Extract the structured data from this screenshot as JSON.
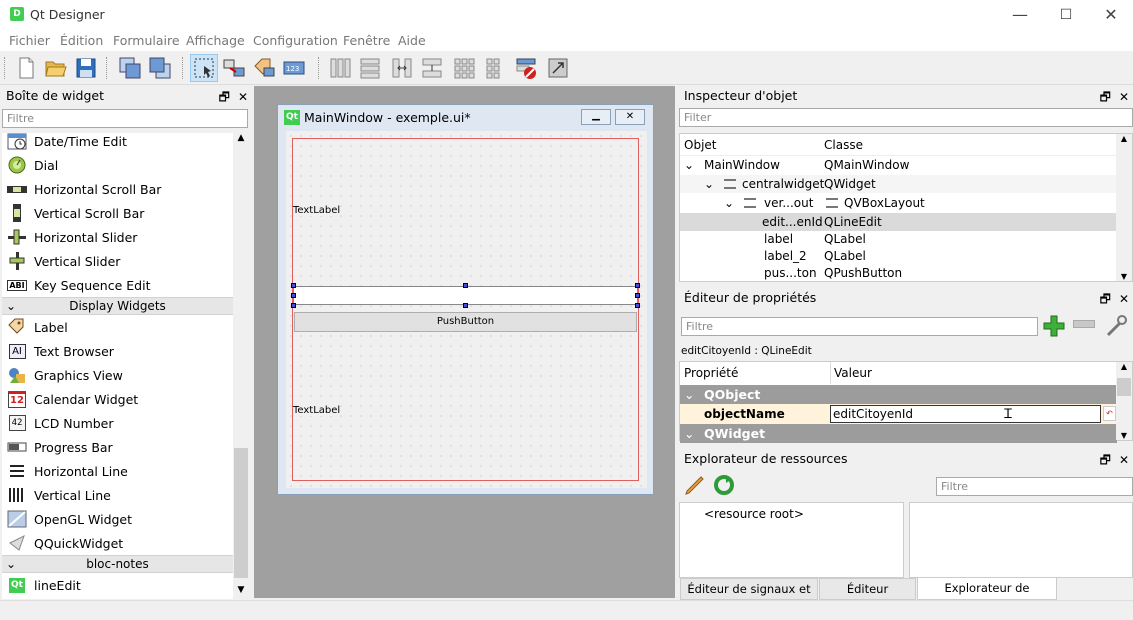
{
  "window": {
    "title": "Qt Designer",
    "icon_letter": "D",
    "minimize": "—",
    "maximize": "☐",
    "close": "✕"
  },
  "menu": [
    "Fichier",
    "Édition",
    "Formulaire",
    "Affichage",
    "Configuration",
    "Fenêtre",
    "Aide"
  ],
  "widget_box": {
    "title": "Boîte de widget",
    "filter_placeholder": "Filtre",
    "items": [
      {
        "label": "Date/Time Edit",
        "icon": "datetime-edit-icon"
      },
      {
        "label": "Dial",
        "icon": "dial-icon"
      },
      {
        "label": "Horizontal Scroll Bar",
        "icon": "hscrollbar-icon"
      },
      {
        "label": "Vertical Scroll Bar",
        "icon": "vscrollbar-icon"
      },
      {
        "label": "Horizontal Slider",
        "icon": "hslider-icon"
      },
      {
        "label": "Vertical Slider",
        "icon": "vslider-icon"
      },
      {
        "label": "Key Sequence Edit",
        "icon": "key-sequence-icon"
      }
    ],
    "category_display": "Display Widgets",
    "display_items": [
      {
        "label": "Label",
        "icon": "label-icon"
      },
      {
        "label": "Text Browser",
        "icon": "text-browser-icon"
      },
      {
        "label": "Graphics View",
        "icon": "graphics-view-icon"
      },
      {
        "label": "Calendar Widget",
        "icon": "calendar-icon"
      },
      {
        "label": "LCD Number",
        "icon": "lcd-number-icon"
      },
      {
        "label": "Progress Bar",
        "icon": "progress-bar-icon"
      },
      {
        "label": "Horizontal Line",
        "icon": "hline-icon"
      },
      {
        "label": "Vertical Line",
        "icon": "vline-icon"
      },
      {
        "label": "OpenGL Widget",
        "icon": "opengl-icon"
      },
      {
        "label": "QQuickWidget",
        "icon": "qquick-icon"
      }
    ],
    "category_notes": "bloc-notes",
    "notes_items": [
      {
        "label": "lineEdit",
        "icon": "qt-icon"
      }
    ],
    "calendar_num": "12",
    "lcd_text": "42",
    "key_seq_text": "ABI",
    "text_browser_text": "AI",
    "qt_text": "Qt"
  },
  "form_window": {
    "title": "MainWindow - exemple.ui*",
    "qt_badge": "Qt",
    "label_top": "TextLabel",
    "label_bottom": "TextLabel",
    "button": "PushButton"
  },
  "inspector": {
    "title": "Inspecteur d'objet",
    "filter_placeholder": "Filter",
    "col_object": "Objet",
    "col_class": "Classe",
    "rows": [
      {
        "obj": "MainWindow",
        "cls": "QMainWindow"
      },
      {
        "obj": "centralwidget",
        "cls": "QWidget"
      },
      {
        "obj": "ver...out",
        "cls": "QVBoxLayout"
      },
      {
        "obj": "edit...enId",
        "cls": "QLineEdit"
      },
      {
        "obj": "label",
        "cls": "QLabel"
      },
      {
        "obj": "label_2",
        "cls": "QLabel"
      },
      {
        "obj": "pus...ton",
        "cls": "QPushButton"
      }
    ]
  },
  "properties": {
    "title": "Éditeur de propriétés",
    "filter_placeholder": "Filtre",
    "context": "editCitoyenId : QLineEdit",
    "col_prop": "Propriété",
    "col_value": "Valeur",
    "cat_qobject": "QObject",
    "prop_name": "objectName",
    "prop_value": "editCitoyenId",
    "cat_qwidget": "QWidget"
  },
  "resources": {
    "title": "Explorateur de ressources",
    "filter_placeholder": "Filtre",
    "root": "<resource root>"
  },
  "bottom_tabs": [
    "Éditeur de signaux et slots",
    "Éditeur d'actions",
    "Explorateur de ressources"
  ],
  "dock_btns": {
    "float": "🗗",
    "close": "✕"
  },
  "colors": {
    "accent": "#41cd52",
    "selection": "#cce4f7",
    "category": "#9c9c9c"
  }
}
